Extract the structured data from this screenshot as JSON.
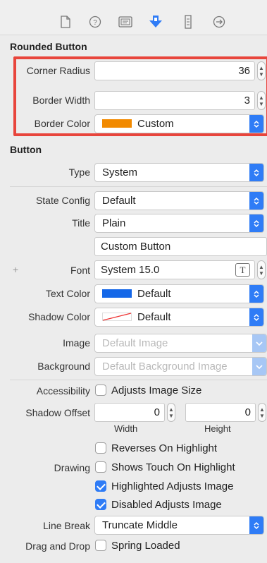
{
  "toolbar": {
    "icons": [
      "file-icon",
      "help-icon",
      "identity-icon",
      "attributes-icon",
      "size-icon",
      "connections-icon"
    ],
    "accent": "#2f7cf6"
  },
  "rounded_button": {
    "title": "Rounded Button",
    "corner_radius_label": "Corner Radius",
    "corner_radius_value": "36",
    "border_width_label": "Border Width",
    "border_width_value": "3",
    "border_color_label": "Border Color",
    "border_color_value": "Custom",
    "border_color_swatch": "#f28a00"
  },
  "button": {
    "title": "Button",
    "type_label": "Type",
    "type_value": "System",
    "state_config_label": "State Config",
    "state_config_value": "Default",
    "title_label": "Title",
    "title_value": "Plain",
    "title_text": "Custom Button",
    "font_label": "Font",
    "font_value": "System 15.0",
    "font_plus": "+",
    "text_color_label": "Text Color",
    "text_color_value": "Default",
    "text_color_swatch": "#1467e8",
    "shadow_color_label": "Shadow Color",
    "shadow_color_value": "Default",
    "image_label": "Image",
    "image_placeholder": "Default Image",
    "background_label": "Background",
    "background_placeholder": "Default Background Image"
  },
  "misc": {
    "accessibility_label": "Accessibility",
    "adjusts_image_size": "Adjusts Image Size",
    "shadow_offset_label": "Shadow Offset",
    "shadow_offset_width": "0",
    "shadow_offset_height": "0",
    "width_label": "Width",
    "height_label": "Height",
    "drawing_label": "Drawing",
    "reverses_on_highlight": "Reverses On Highlight",
    "shows_touch_on_highlight": "Shows Touch On Highlight",
    "highlighted_adjusts_image": "Highlighted Adjusts Image",
    "disabled_adjusts_image": "Disabled Adjusts Image",
    "line_break_label": "Line Break",
    "line_break_value": "Truncate Middle",
    "drag_and_drop_label": "Drag and Drop",
    "spring_loaded": "Spring Loaded"
  },
  "checks": {
    "adjusts_image_size": false,
    "reverses_on_highlight": false,
    "shows_touch_on_highlight": false,
    "highlighted_adjusts_image": true,
    "disabled_adjusts_image": true,
    "spring_loaded": false
  }
}
